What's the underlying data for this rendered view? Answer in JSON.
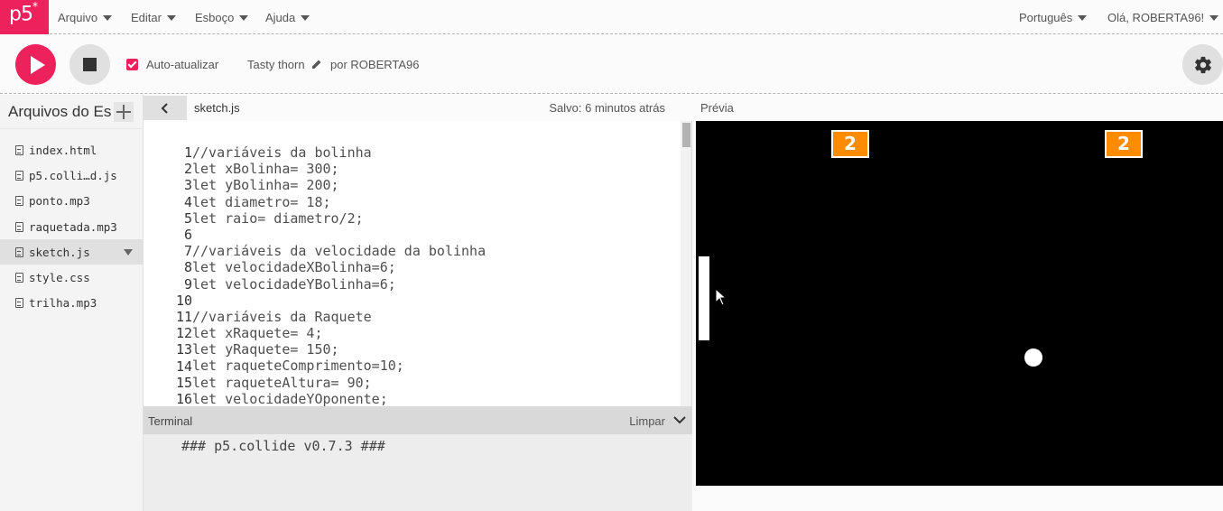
{
  "nav": {
    "logo": "p5",
    "logo_sup": "*",
    "menus": [
      "Arquivo",
      "Editar",
      "Esboço",
      "Ajuda"
    ],
    "language": "Português",
    "user": "Olá, ROBERTA96!"
  },
  "toolbar": {
    "auto_refresh_label": "Auto-atualizar",
    "auto_refresh_checked": true,
    "sketch_name": "Tasty thorn",
    "author": "por ROBERTA96"
  },
  "sidebar": {
    "title": "Arquivos do Es",
    "files": [
      {
        "name": "index.html",
        "selected": false
      },
      {
        "name": "p5.colli…d.js",
        "selected": false
      },
      {
        "name": "ponto.mp3",
        "selected": false
      },
      {
        "name": "raquetada.mp3",
        "selected": false
      },
      {
        "name": "sketch.js",
        "selected": true
      },
      {
        "name": "style.css",
        "selected": false
      },
      {
        "name": "trilha.mp3",
        "selected": false
      }
    ]
  },
  "editor": {
    "filename": "sketch.js",
    "saved": "Salvo: 6 minutos atrás",
    "line_numbers": [
      "1",
      "2",
      "3",
      "4",
      "5",
      "6",
      "7",
      "8",
      "9",
      "10",
      "11",
      "12",
      "13",
      "14",
      "15",
      "16"
    ],
    "code_lines": [
      "//variáveis da bolinha",
      "let xBolinha= 300;",
      "let yBolinha= 200;",
      "let diametro= 18;",
      "let raio= diametro/2;",
      "",
      "//variáveis da velocidade da bolinha",
      "let velocidadeXBolinha=6;",
      "let velocidadeYBolinha=6;",
      "",
      "//variáveis da Raquete",
      "let xRaquete= 4;",
      "let yRaquete= 150;",
      "let raqueteComprimento=10;",
      "let raqueteAltura= 90;",
      "let velocidadeYOponente;"
    ]
  },
  "terminal": {
    "title": "Terminal",
    "clear": "Limpar",
    "message": "### p5.collide v0.7.3 ###"
  },
  "preview": {
    "title": "Prévia",
    "score_left": "2",
    "score_right": "2"
  },
  "colors": {
    "accent": "#ed225d",
    "score_bg": "#ff8c00",
    "canvas_bg": "#000000"
  }
}
